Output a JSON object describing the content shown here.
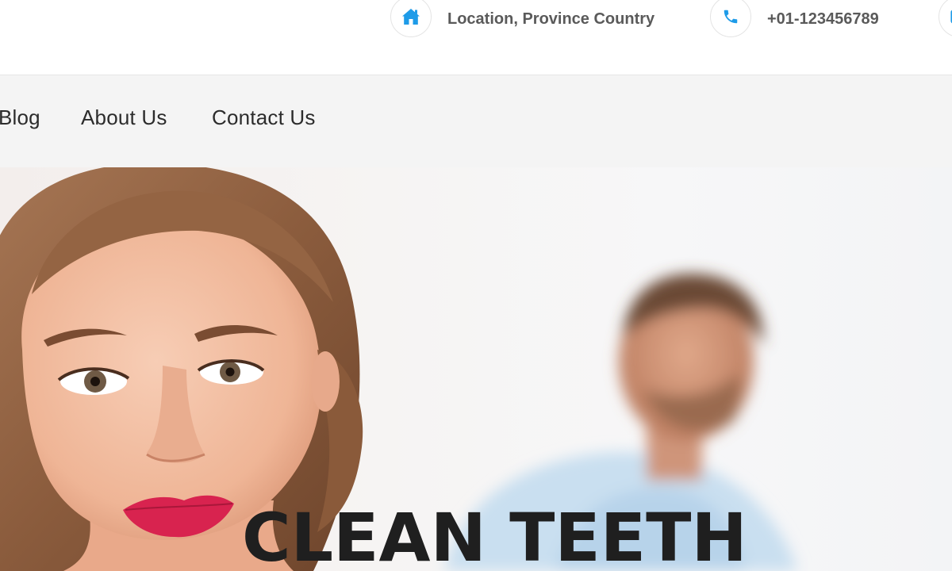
{
  "topbar": {
    "location": {
      "icon": "home-icon",
      "text": "Location, Province Country"
    },
    "phone": {
      "icon": "phone-icon",
      "text": "+01-123456789"
    },
    "email": {
      "icon": "envelope-icon"
    }
  },
  "nav": {
    "items": [
      {
        "label": "Blog"
      },
      {
        "label": "About Us"
      },
      {
        "label": "Contact Us"
      }
    ]
  },
  "hero": {
    "title": "CLEAN TEETH"
  },
  "colors": {
    "accent": "#1e9be8",
    "nav_bg": "#f4f4f4",
    "title": "#1f1f1f"
  }
}
